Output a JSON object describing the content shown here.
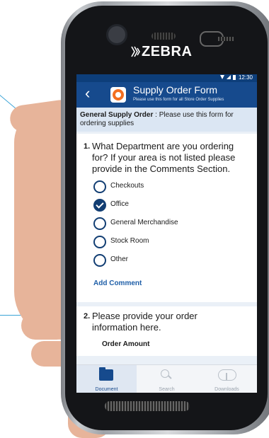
{
  "device": {
    "brand": "ZEBRA"
  },
  "status_bar": {
    "time": "12:30"
  },
  "app_bar": {
    "title": "Supply Order Form",
    "subtitle": "Please use this form for all Store Order Supplies"
  },
  "info": {
    "bold": "General Supply Order",
    "text": " : Please use this form for ordering supplies"
  },
  "question1": {
    "number": "1.",
    "text": "What Department are you ordering for? If your area is not listed please provide in the Comments Section.",
    "options": [
      {
        "label": "Checkouts",
        "checked": false
      },
      {
        "label": "Office",
        "checked": true
      },
      {
        "label": "General Merchandise",
        "checked": false
      },
      {
        "label": "Stock Room",
        "checked": false
      },
      {
        "label": "Other",
        "checked": false
      }
    ],
    "add_comment": "Add Comment"
  },
  "question2": {
    "number": "2.",
    "text": "Please provide your order information here.",
    "field_label": "Order Amount"
  },
  "bottom_nav": [
    {
      "label": "Document",
      "icon": "folder-icon",
      "active": true
    },
    {
      "label": "Search",
      "icon": "search-icon",
      "active": false
    },
    {
      "label": "Downloads",
      "icon": "cloud-download-icon",
      "active": false
    }
  ],
  "colors": {
    "primary": "#164a8d",
    "accent": "#1f5fa8",
    "status": "#0d3e7a"
  }
}
